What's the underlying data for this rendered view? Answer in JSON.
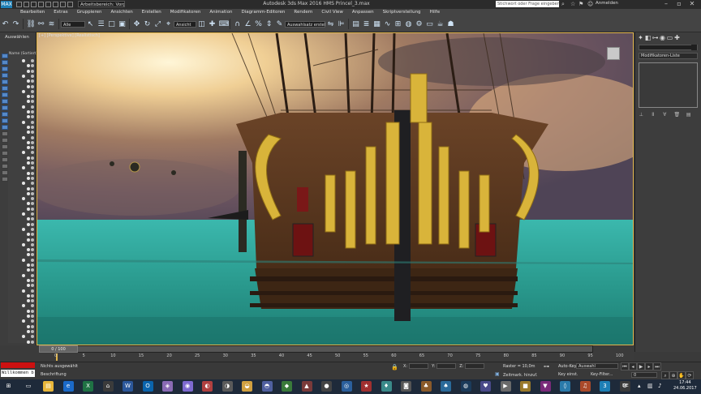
{
  "titlebar": {
    "app_logo": "MAX",
    "workspace": "Arbeitsbereich: Vorga",
    "window_title": "Autodesk 3ds Max 2016     HMS Princel_3.max",
    "search_placeholder": "Stichwort oder Frage eingeben",
    "signin": "Anmelden"
  },
  "menu": [
    "Bearbeiten",
    "Extras",
    "Gruppieren",
    "Ansichten",
    "Erstellen",
    "Modifikatoren",
    "Animation",
    "Diagramm-Editoren",
    "Rendern",
    "Civil View",
    "Anpassen",
    "Skriptverstellung",
    "Hilfe"
  ],
  "toolbar": {
    "selection_filter": "Alle",
    "reference_coord": "Ansicht",
    "named_selection": "Auswahlsatz erstel"
  },
  "left": {
    "label": "Auswählen",
    "explorer_title": "Name (Sortiert)"
  },
  "viewport": {
    "label": "[+] [Perspektive] [Realistisch]"
  },
  "right_panel": {
    "modifier_list": "Modifikatoren-Liste"
  },
  "timeline": {
    "slider": "0 / 100",
    "ticks": [
      "0",
      "5",
      "10",
      "15",
      "20",
      "25",
      "30",
      "35",
      "40",
      "45",
      "50",
      "55",
      "60",
      "65",
      "70",
      "75",
      "80",
      "85",
      "90",
      "95",
      "100"
    ]
  },
  "status": {
    "maxscript": "Willkommen b",
    "selected": "Nichts ausgewählt",
    "prompt": "Beschriftung",
    "x": "",
    "y": "",
    "z": "",
    "grid": "Raster = 10,0m",
    "time_tag": "Zeitmark. hinzuf.",
    "autokey": "Auto-Key",
    "autokey_sel": "Auswahl",
    "setkey": "Key einst.",
    "keyfilter": "Key-Filter...",
    "frame": "0"
  },
  "taskbar": {
    "lang": "DE",
    "time": "17:44",
    "date": "24.06.2017"
  },
  "colors": {
    "viewport_border": "#e1b54b",
    "sea": "#2a9a8e",
    "gold": "#d9b43a"
  }
}
